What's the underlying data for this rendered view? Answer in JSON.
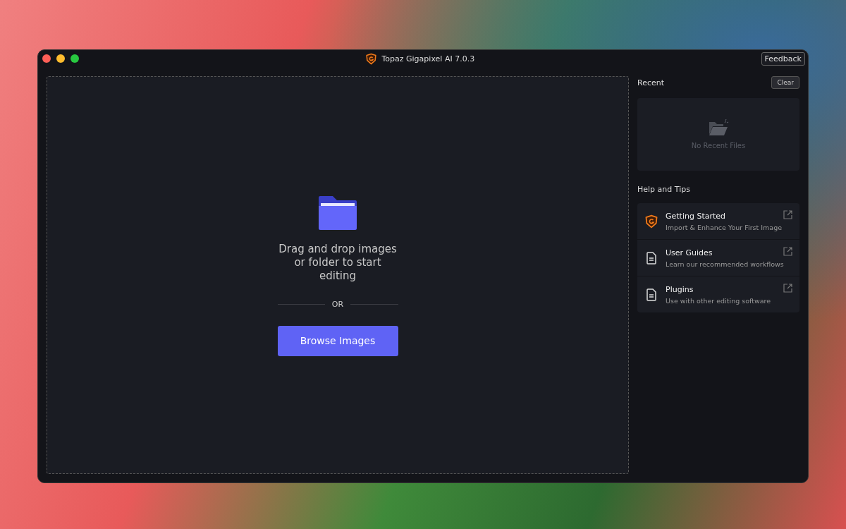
{
  "window": {
    "title": "Topaz Gigapixel AI 7.0.3",
    "feedback_button": "Feedback"
  },
  "drop_zone": {
    "message": "Drag and drop images or folder to start editing",
    "divider": "OR",
    "button": "Browse Images"
  },
  "recent": {
    "heading": "Recent",
    "clear_button": "Clear",
    "empty_text": "No Recent Files"
  },
  "help": {
    "heading": "Help and Tips",
    "items": [
      {
        "kind": "logo",
        "title": "Getting Started",
        "subtitle": "Import & Enhance Your First Image"
      },
      {
        "kind": "document",
        "title": "User Guides",
        "subtitle": "Learn our recommended workflows"
      },
      {
        "kind": "document",
        "title": "Plugins",
        "subtitle": "Use with other editing software"
      }
    ]
  }
}
